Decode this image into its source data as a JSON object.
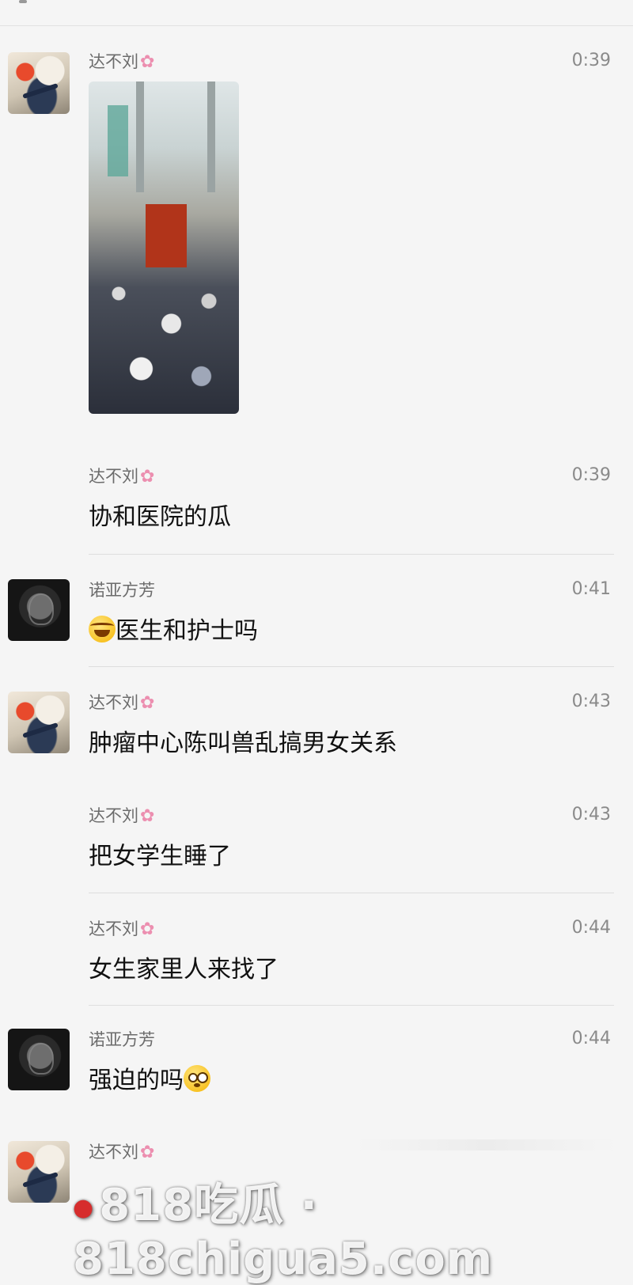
{
  "messages": [
    {
      "name": "达不刘",
      "time": "0:39",
      "text": ""
    },
    {
      "name": "达不刘",
      "time": "0:39",
      "text": "协和医院的瓜"
    },
    {
      "name": "诺亚方芳",
      "time": "0:41",
      "text": "医生和护士吗"
    },
    {
      "name": "达不刘",
      "time": "0:43",
      "text": "肿瘤中心陈叫兽乱搞男女关系"
    },
    {
      "name": "达不刘",
      "time": "0:43",
      "text": "把女学生睡了"
    },
    {
      "name": "达不刘",
      "time": "0:44",
      "text": "女生家里人来找了"
    },
    {
      "name": "诺亚方芳",
      "time": "0:44",
      "text": "强迫的吗"
    },
    {
      "name": "达不刘",
      "time": "",
      "text": ""
    }
  ],
  "flower_glyph": "✿",
  "watermark": "818吃瓜 · 818chigua5.com",
  "icons": {
    "flower": "cherry-blossom-icon",
    "emoji_1": "laughing-tears-emoji-icon",
    "emoji_2": "flushed-face-emoji-icon"
  }
}
